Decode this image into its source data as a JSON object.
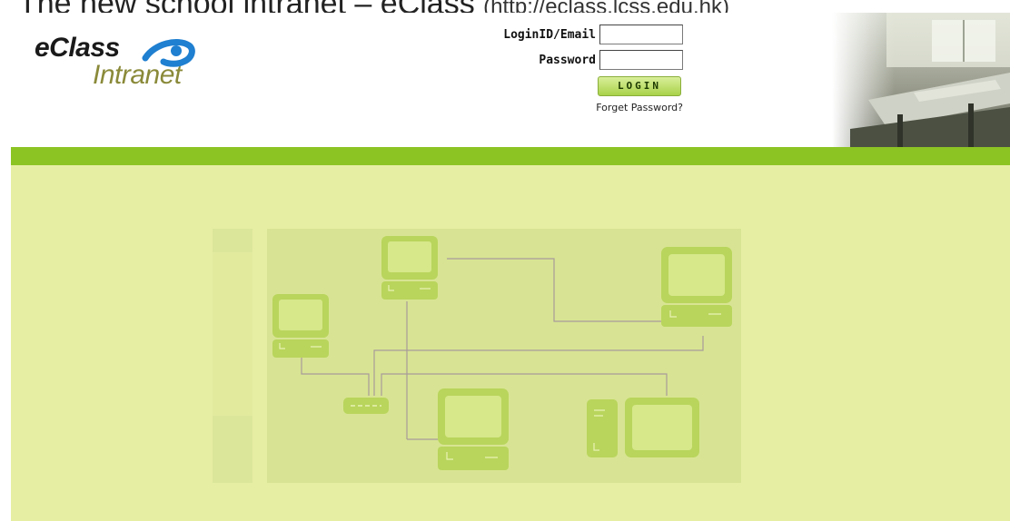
{
  "caption": {
    "text": "The new school intranet – eClass",
    "url": "(http://eclass.lcss.edu.hk)"
  },
  "logo": {
    "word1": "eClass",
    "word2": "Intranet"
  },
  "login": {
    "username_label": "LoginID/Email",
    "password_label": "Password",
    "username_value": "",
    "password_value": "",
    "button_label": "LOGIN",
    "forgot_label": "Forget Password?"
  },
  "colors": {
    "accent_bar": "#8cc424",
    "panel_bg": "#e6eea3",
    "button": "#a9d24a"
  },
  "icons": {
    "logo_swoosh": "swoosh-icon",
    "network": "network-diagram-icon"
  }
}
